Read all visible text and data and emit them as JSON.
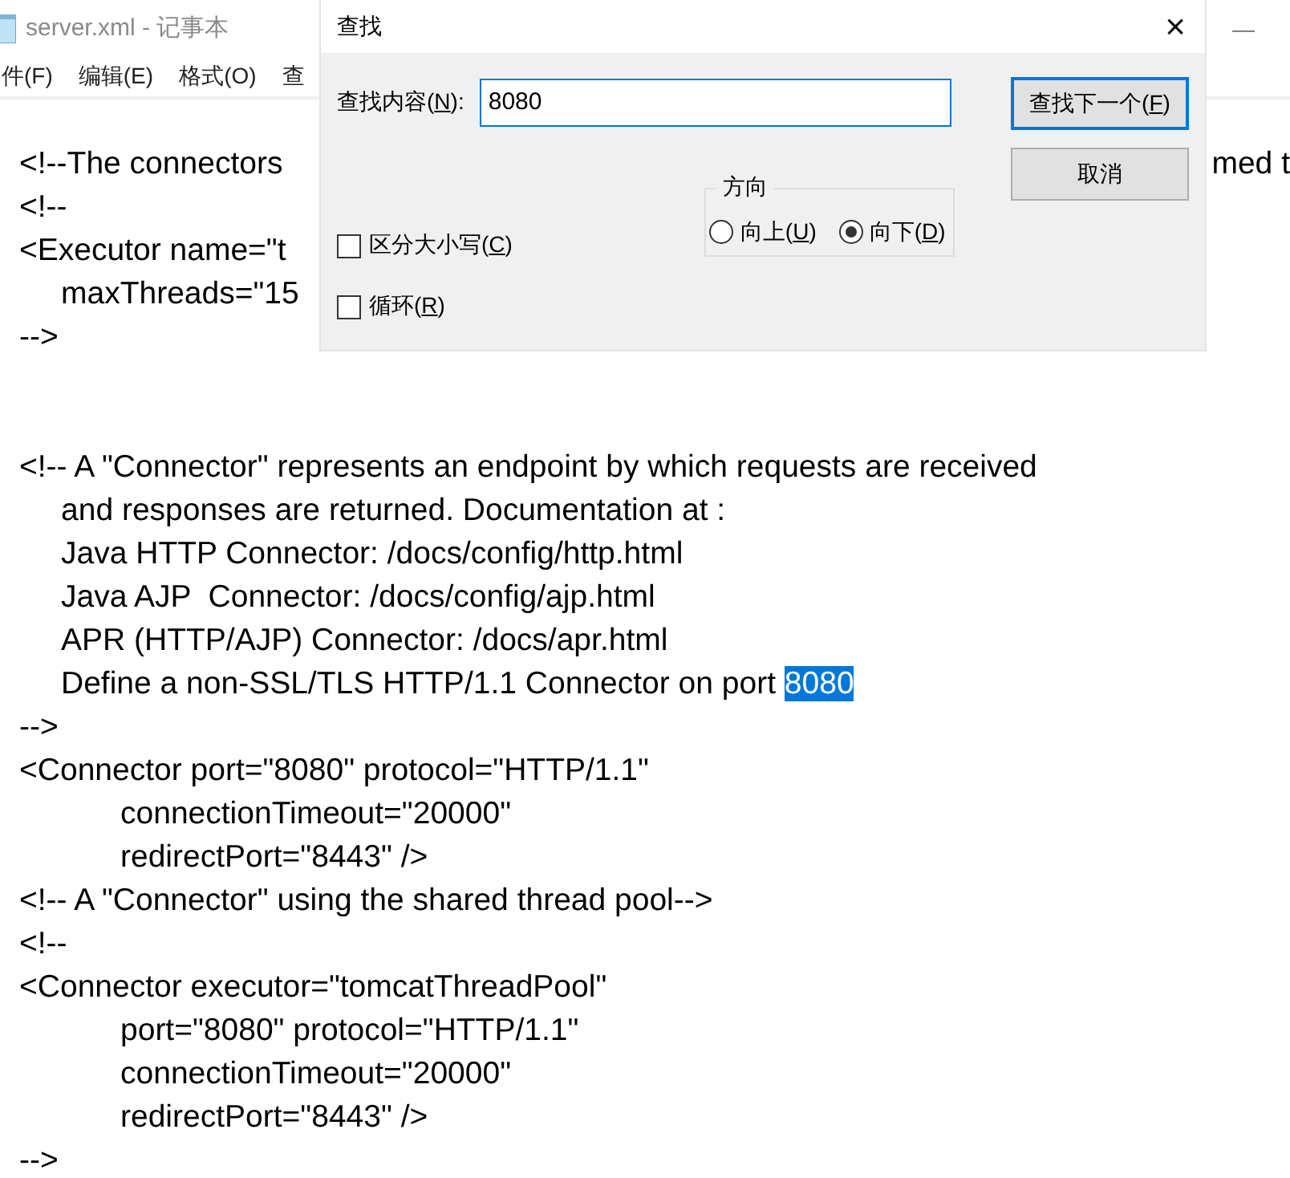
{
  "window": {
    "title": "server.xml - 记事本",
    "minimize": "—"
  },
  "menu": [
    {
      "label": "件(F)"
    },
    {
      "label": "编辑(E)"
    },
    {
      "label": "格式(O)"
    },
    {
      "label": "查"
    }
  ],
  "editor_lines": [
    {
      "kind": "top",
      "text": "<!--The connectors",
      "right": "med t"
    },
    {
      "kind": "top",
      "text": "<!--"
    },
    {
      "kind": "top",
      "text": "<Executor name=\"t"
    },
    {
      "kind": "sub",
      "text": "maxThreads=\"15"
    },
    {
      "kind": "top",
      "text": "-->"
    },
    {
      "kind": "blank"
    },
    {
      "kind": "blank"
    },
    {
      "kind": "top",
      "text": "<!-- A \"Connector\" represents an endpoint by which requests are received"
    },
    {
      "kind": "sub",
      "text": "and responses are returned. Documentation at :"
    },
    {
      "kind": "sub",
      "text": "Java HTTP Connector: /docs/config/http.html"
    },
    {
      "kind": "sub",
      "text": "Java AJP  Connector: /docs/config/ajp.html"
    },
    {
      "kind": "sub",
      "text": "APR (HTTP/AJP) Connector: /docs/apr.html"
    },
    {
      "kind": "sub",
      "text": "Define a non-SSL/TLS HTTP/1.1 Connector on port ",
      "match": "8080"
    },
    {
      "kind": "top",
      "text": "-->"
    },
    {
      "kind": "top",
      "text": "<Connector port=\"8080\" protocol=\"HTTP/1.1\""
    },
    {
      "kind": "attr",
      "text": "connectionTimeout=\"20000\""
    },
    {
      "kind": "attr",
      "text": "redirectPort=\"8443\" />"
    },
    {
      "kind": "top",
      "text": "<!-- A \"Connector\" using the shared thread pool-->"
    },
    {
      "kind": "top",
      "text": "<!--"
    },
    {
      "kind": "top",
      "text": "<Connector executor=\"tomcatThreadPool\""
    },
    {
      "kind": "attr",
      "text": "port=\"8080\" protocol=\"HTTP/1.1\""
    },
    {
      "kind": "attr",
      "text": "connectionTimeout=\"20000\""
    },
    {
      "kind": "attr",
      "text": "redirectPort=\"8443\" />"
    },
    {
      "kind": "top",
      "text": "-->"
    }
  ],
  "find_dialog": {
    "title": "查找",
    "close": "×",
    "find_label": {
      "before": "查找内容(",
      "key": "N",
      "after": "):"
    },
    "find_value": "8080",
    "buttons": [
      {
        "before": "查找下一个(",
        "key": "F",
        "after": ")",
        "default": true
      },
      {
        "before": "取消",
        "default": false
      }
    ],
    "direction": {
      "label": "方向",
      "options": [
        {
          "before": "向上(",
          "key": "U",
          "after": ")",
          "selected": false
        },
        {
          "before": "向下(",
          "key": "D",
          "after": ")",
          "selected": true
        }
      ]
    },
    "checkboxes": [
      {
        "before": "区分大小写(",
        "key": "C",
        "after": ")",
        "checked": false
      },
      {
        "before": "循环(",
        "key": "R",
        "after": ")",
        "checked": false
      }
    ]
  }
}
